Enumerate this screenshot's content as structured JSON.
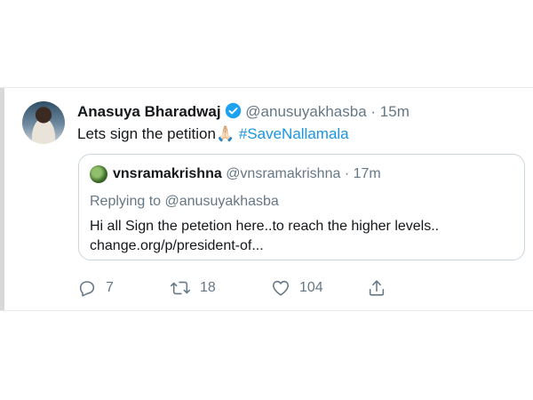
{
  "tweet": {
    "author_name": "Anasuya Bharadwaj",
    "handle": "@anusuyakhasba",
    "separator": "·",
    "time": "15m",
    "text": "Lets sign the petition🙏🏻 ",
    "hashtag": "#SaveNallamala",
    "verified_icon": "verified-badge-icon",
    "accent_color": "#1b95e0"
  },
  "quoted": {
    "author_name": "vnsramakrishna",
    "handle": "@vnsramakrishna",
    "separator": "·",
    "time": "17m",
    "replying_label": "Replying to ",
    "replying_handle": "@anusuyakhasba",
    "line1": "Hi all Sign the petetion here..to reach the higher levels..",
    "line2": "change.org/p/president-of..."
  },
  "actions": {
    "reply_count": "7",
    "retweet_count": "18",
    "like_count": "104",
    "icons": [
      "reply-icon",
      "retweet-icon",
      "like-icon",
      "share-icon"
    ]
  }
}
